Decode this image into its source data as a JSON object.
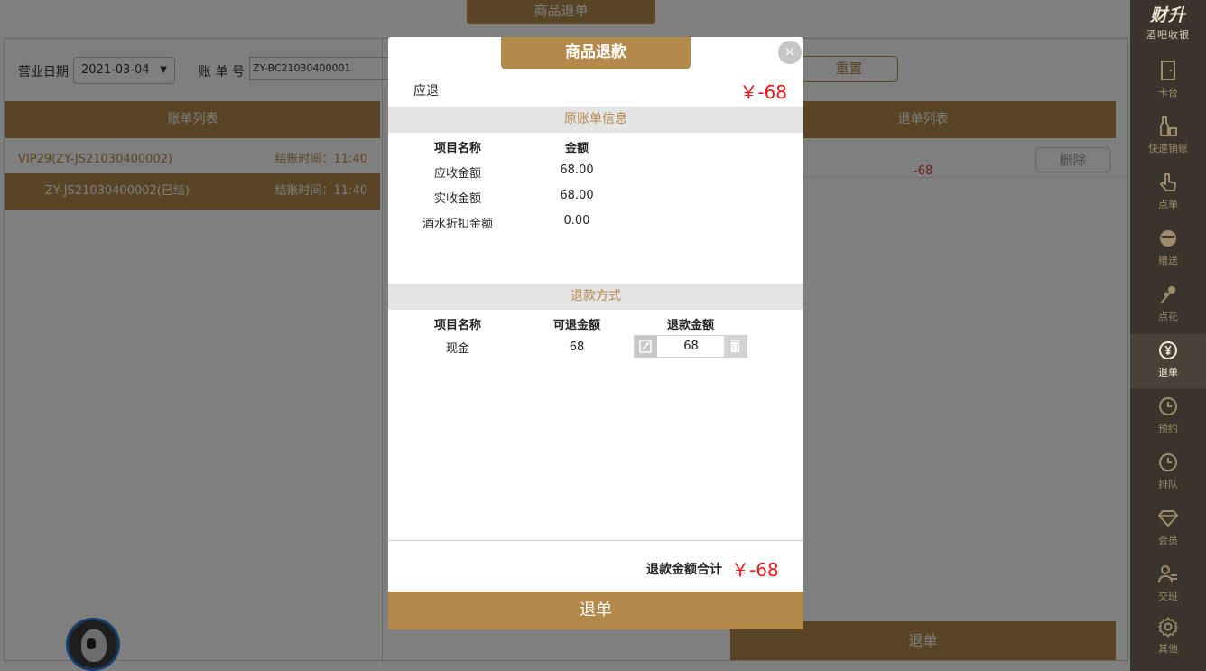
{
  "page": {
    "tab_title": "商品退单"
  },
  "filter": {
    "date_label": "营业日期",
    "date_value": "2021-03-04",
    "bill_label": "账 单 号",
    "bill_value": "ZY-BC21030400001",
    "reset_label": "重置"
  },
  "bill_list": {
    "header": "账单列表",
    "rows": [
      {
        "name": "VIP29(ZY-JS21030400002)",
        "time": "结账时间：11:40"
      },
      {
        "name": "ZY-JS21030400002(已结)",
        "time": "结账时间：11:40"
      }
    ]
  },
  "refund_list": {
    "header": "退单列表",
    "amount": "-68",
    "delete_label": "删除",
    "submit_label": "退单"
  },
  "sidebar": {
    "brand": "财升",
    "brand_sub": "酒吧收银",
    "items": [
      {
        "label": "卡台",
        "icon": "door-icon"
      },
      {
        "label": "快速销账",
        "icon": "bottle-icon"
      },
      {
        "label": "点单",
        "icon": "hand-pointer-icon"
      },
      {
        "label": "赠送",
        "icon": "gift-icon"
      },
      {
        "label": "点花",
        "icon": "flower-icon"
      },
      {
        "label": "退单",
        "icon": "yen-refund-icon",
        "active": true
      },
      {
        "label": "预约",
        "icon": "clock-icon"
      },
      {
        "label": "排队",
        "icon": "clock-icon"
      },
      {
        "label": "会员",
        "icon": "diamond-icon"
      },
      {
        "label": "交班",
        "icon": "handover-icon"
      },
      {
        "label": "其他",
        "icon": "gear-icon"
      }
    ]
  },
  "modal": {
    "title": "商品退款",
    "close_symbol": "×",
    "due_label": "应退",
    "due_value": "￥-68",
    "original_section": "原账单信息",
    "original_headers": [
      "项目名称",
      "金额"
    ],
    "original_rows": [
      {
        "name": "应收金额",
        "amount": "68.00"
      },
      {
        "name": "实收金额",
        "amount": "68.00"
      },
      {
        "name": "酒水折扣金额",
        "amount": "0.00"
      }
    ],
    "method_section": "退款方式",
    "method_headers": [
      "项目名称",
      "可退金额",
      "退款金额"
    ],
    "method_rows": [
      {
        "name": "现金",
        "refundable": "68",
        "refund": "68"
      }
    ],
    "total_label": "退款金额合计",
    "total_value": "￥-68",
    "submit_label": "退单"
  },
  "colors": {
    "accent": "#b3894c",
    "negative": "#f01818",
    "sidebar_bg": "#3a342c"
  }
}
